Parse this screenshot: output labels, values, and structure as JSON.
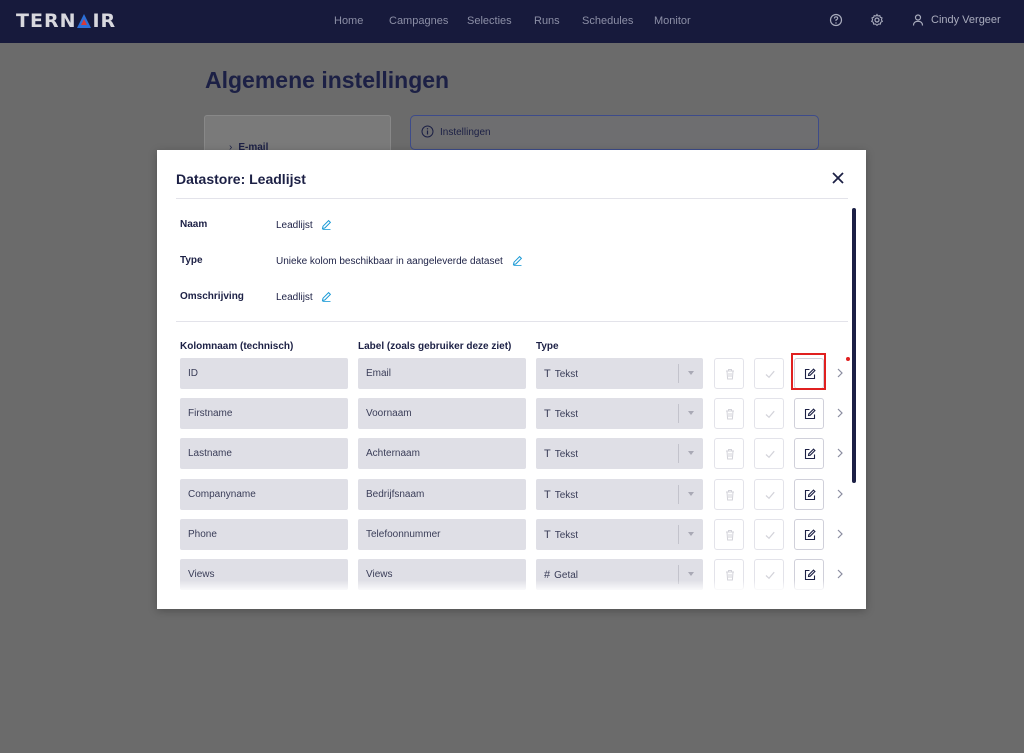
{
  "app": {
    "logo": "TERNAIR",
    "nav": [
      "Home",
      "Campagnes",
      "Selecties",
      "Runs",
      "Schedules",
      "Monitor"
    ],
    "user_name": "Cindy Vergeer"
  },
  "page": {
    "title": "Algemene instellingen",
    "sidebar_item": "E-mail",
    "settings_tab": "Instellingen"
  },
  "modal": {
    "title": "Datastore: Leadlijst",
    "meta": [
      {
        "label": "Naam",
        "value": "Leadlijst"
      },
      {
        "label": "Type",
        "value": "Unieke kolom beschikbaar in aangeleverde dataset"
      },
      {
        "label": "Omschrijving",
        "value": "Leadlijst"
      }
    ],
    "columns": {
      "technical": "Kolomnaam (technisch)",
      "label": "Label (zoals gebruiker deze ziet)",
      "type": "Type"
    },
    "rows": [
      {
        "name": "ID",
        "label": "Email",
        "type": "Tekst",
        "type_icon": "T"
      },
      {
        "name": "Firstname",
        "label": "Voornaam",
        "type": "Tekst",
        "type_icon": "T"
      },
      {
        "name": "Lastname",
        "label": "Achternaam",
        "type": "Tekst",
        "type_icon": "T"
      },
      {
        "name": "Companyname",
        "label": "Bedrijfsnaam",
        "type": "Tekst",
        "type_icon": "T"
      },
      {
        "name": "Phone",
        "label": "Telefoonnummer",
        "type": "Tekst",
        "type_icon": "T"
      },
      {
        "name": "Views",
        "label": "Views",
        "type": "Getal",
        "type_icon": "#"
      }
    ]
  },
  "colors": {
    "nav_bg": "#171a3c",
    "accent": "#1c2045",
    "highlight": "#e02020",
    "pen": "#1a9ad6"
  }
}
